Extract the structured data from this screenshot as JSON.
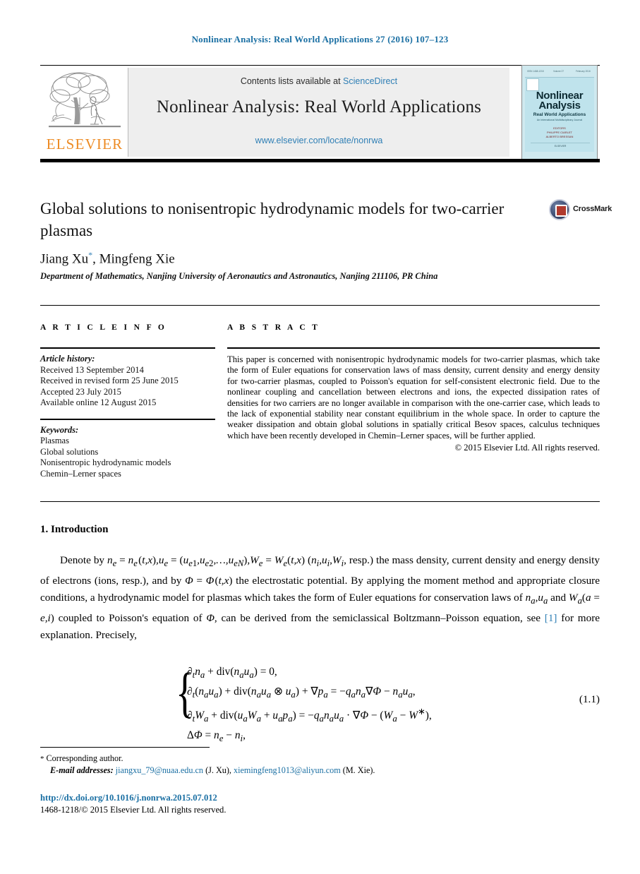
{
  "running_head": "Nonlinear Analysis: Real World Applications 27 (2016) 107–123",
  "masthead": {
    "contents_prefix": "Contents lists available at ",
    "sciencedirect": "ScienceDirect",
    "journal_title": "Nonlinear Analysis: Real World Applications",
    "journal_url": "www.elsevier.com/locate/nonrwa",
    "publisher_name": "ELSEVIER",
    "cover": {
      "title_line1": "Nonlinear",
      "title_line2": "Analysis",
      "subtitle": "Real World Applications",
      "sub_note": "An International Multidisciplinary Journal",
      "editors": "EDITORS\nPHILIPPE CIARLET\nALBERTO BRESSAN",
      "bottom_note": "ELSEVIER",
      "top_left": "ISSN 1468-1218",
      "top_mid": "Volume 27",
      "top_right": "February 2016"
    }
  },
  "article": {
    "title": "Global solutions to nonisentropic hydrodynamic models for two-carrier plasmas",
    "crossmark_label": "CrossMark",
    "authors": "Jiang Xu",
    "author_star": "*",
    "authors_rest": ", Mingfeng Xie",
    "affiliation": "Department of Mathematics, Nanjing University of Aeronautics and Astronautics, Nanjing 211106, PR China"
  },
  "info": {
    "heading": "A R T I C L E   I N F O",
    "history_label": "Article history:",
    "history": [
      "Received 13 September 2014",
      "Received in revised form 25 June 2015",
      "Accepted 23 July 2015",
      "Available online 12 August 2015"
    ],
    "keywords_label": "Keywords:",
    "keywords": [
      "Plasmas",
      "Global solutions",
      "Nonisentropic hydrodynamic models",
      "Chemin–Lerner spaces"
    ]
  },
  "abstract": {
    "heading": "A B S T R A C T",
    "text": "This paper is concerned with nonisentropic hydrodynamic models for two-carrier plasmas, which take the form of Euler equations for conservation laws of mass density, current density and energy density for two-carrier plasmas, coupled to Poisson's equation for self-consistent electronic field. Due to the nonlinear coupling and cancellation between electrons and ions, the expected dissipation rates of densities for two carriers are no longer available in comparison with the one-carrier case, which leads to the lack of exponential stability near constant equilibrium in the whole space. In order to capture the weaker dissipation and obtain global solutions in spatially critical Besov spaces, calculus techniques which have been recently developed in Chemin–Lerner spaces, will be further applied.",
    "copyright": "© 2015 Elsevier Ltd. All rights reserved."
  },
  "body": {
    "section_heading": "1. Introduction",
    "paragraph_part1": "Denote by n",
    "reference_marker": "[1]",
    "equation_number": "(1.1)"
  },
  "footnotes": {
    "corresponding_star": "*",
    "corresponding": "Corresponding author.",
    "email_label": "E-mail addresses:",
    "email1": "jiangxu_79@nuaa.edu.cn",
    "email1_owner": "(J. Xu),",
    "email2": "xiemingfeng1013@aliyun.com",
    "email2_owner": "(M. Xie).",
    "doi": "http://dx.doi.org/10.1016/j.nonrwa.2015.07.012",
    "issn_line": "1468-1218/© 2015 Elsevier Ltd. All rights reserved."
  },
  "colors": {
    "link_blue": "#1a6fa3",
    "science_direct_blue": "#2f7fb5",
    "elsevier_orange": "#ed8b24",
    "cover_cyan": "#bfe3ec"
  }
}
